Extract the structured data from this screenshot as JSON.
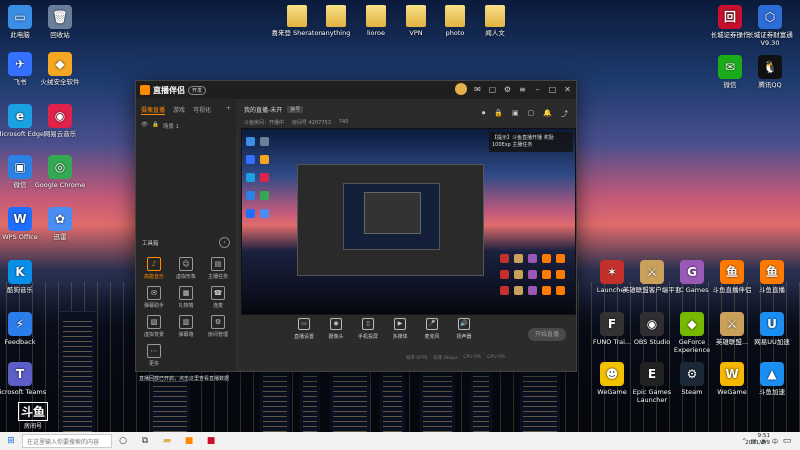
{
  "desktop": {
    "left_icons": [
      {
        "label": "此电脑",
        "glyph": "▭",
        "color": "#3a8ee6"
      },
      {
        "label": "回收站",
        "glyph": "🗑",
        "color": "#6a7f9a"
      },
      {
        "label": "飞书",
        "glyph": "✈",
        "color": "#3370ff"
      },
      {
        "label": "火绒安全软件",
        "glyph": "◆",
        "color": "#f5a623"
      },
      {
        "label": "Microsoft Edge",
        "glyph": "e",
        "color": "#1ba1e2"
      },
      {
        "label": "网易云音乐",
        "glyph": "◉",
        "color": "#e0224a"
      },
      {
        "label": "微信",
        "glyph": "▣",
        "color": "#2a82e4"
      },
      {
        "label": "Google Chrome",
        "glyph": "◎",
        "color": "#34a853"
      },
      {
        "label": "WPS Office",
        "glyph": "W",
        "color": "#1e6fff"
      },
      {
        "label": "迅雷",
        "glyph": "✿",
        "color": "#4a8ef5"
      },
      {
        "label": "酷狗音乐",
        "glyph": "K",
        "color": "#0a8fe8"
      },
      {
        "label": "Feedback",
        "glyph": "⚡",
        "color": "#2b7de9"
      },
      {
        "label": "Microsoft Teams",
        "glyph": "T",
        "color": "#5b5fc7"
      }
    ],
    "top_folders": [
      "喜来登 Sheraton",
      "anything",
      "lioroe",
      "VPN",
      "photo",
      "闻人文"
    ],
    "top_right_icons": [
      {
        "label": "长城证券操作",
        "glyph": "回",
        "color": "#c8102e"
      },
      {
        "label": "长城证券财富通V9.30",
        "glyph": "⬡",
        "color": "#2d6bd6"
      },
      {
        "label": "微信",
        "glyph": "✉",
        "color": "#1aad19"
      },
      {
        "label": "腾讯QQ",
        "glyph": "🐧",
        "color": "#111"
      }
    ],
    "right_grid_icons": [
      {
        "label": "Launcher",
        "glyph": "✶",
        "color": "#c4302b"
      },
      {
        "label": "英雄联盟客户端平台",
        "glyph": "⚔",
        "color": "#c9a15a"
      },
      {
        "label": "TC Games",
        "glyph": "G",
        "color": "#9b59b6"
      },
      {
        "label": "斗鱼直播伴侣",
        "glyph": "鱼",
        "color": "#ff7a00"
      },
      {
        "label": "斗鱼直播",
        "glyph": "鱼",
        "color": "#ff7a00"
      },
      {
        "label": "FUNO Trai...",
        "glyph": "F",
        "color": "#333"
      },
      {
        "label": "OBS Studio",
        "glyph": "◉",
        "color": "#302e31"
      },
      {
        "label": "GeForce Experience",
        "glyph": "◆",
        "color": "#76b900"
      },
      {
        "label": "英雄联盟...",
        "glyph": "⚔",
        "color": "#c9a15a"
      },
      {
        "label": "网易UU加速",
        "glyph": "U",
        "color": "#1b8ef2"
      },
      {
        "label": "WeGame",
        "glyph": "☻",
        "color": "#f2c200"
      },
      {
        "label": "Epic Games Launcher",
        "glyph": "E",
        "color": "#222"
      },
      {
        "label": "Steam",
        "glyph": "⚙",
        "color": "#1b2838"
      },
      {
        "label": "WeGame",
        "glyph": "W",
        "color": "#f5b700"
      },
      {
        "label": "斗鱼加速",
        "glyph": "▲",
        "color": "#1b8ef2"
      }
    ]
  },
  "window": {
    "app_name": "直播伴侣",
    "badge": "开发",
    "left_tabs": [
      "摄像直播",
      "游戏",
      "可视化"
    ],
    "scene_label": "场景 1",
    "toolbox_title": "工具箱",
    "tools": [
      "高能音乐",
      "虚拟形象",
      "主播任务",
      "弹幕助手",
      "礼物墙",
      "连麦",
      "虚拟背景",
      "弹幕墙",
      "房间管理",
      "更多"
    ],
    "room_title": "我的直播-未开",
    "room_chip": "换号",
    "room_meta": [
      "斗鱼房间：开播中",
      "房间号 4207753",
      "740"
    ],
    "notify_text": "【提示】斗鱼直播开播 奖励 100Exp 主播任务",
    "bottom_actions": [
      "直播设置",
      "摄像头",
      "手机投屏",
      "多媒体",
      "麦克风",
      "扬声器"
    ],
    "go_live": "开始直播",
    "announcement": "直播回放已开启，点击这里查看直播数据",
    "stats": [
      "帧率 0FPS",
      "码率 0kbps",
      "CPU 0%",
      "GPU 0%"
    ]
  },
  "taskbar": {
    "search_placeholder": "在这里输入你要搜索的内容",
    "time": "9:51",
    "date": "2021/8/9",
    "lang": "中"
  },
  "watermark": {
    "brand": "斗鱼",
    "room": "房间号"
  }
}
